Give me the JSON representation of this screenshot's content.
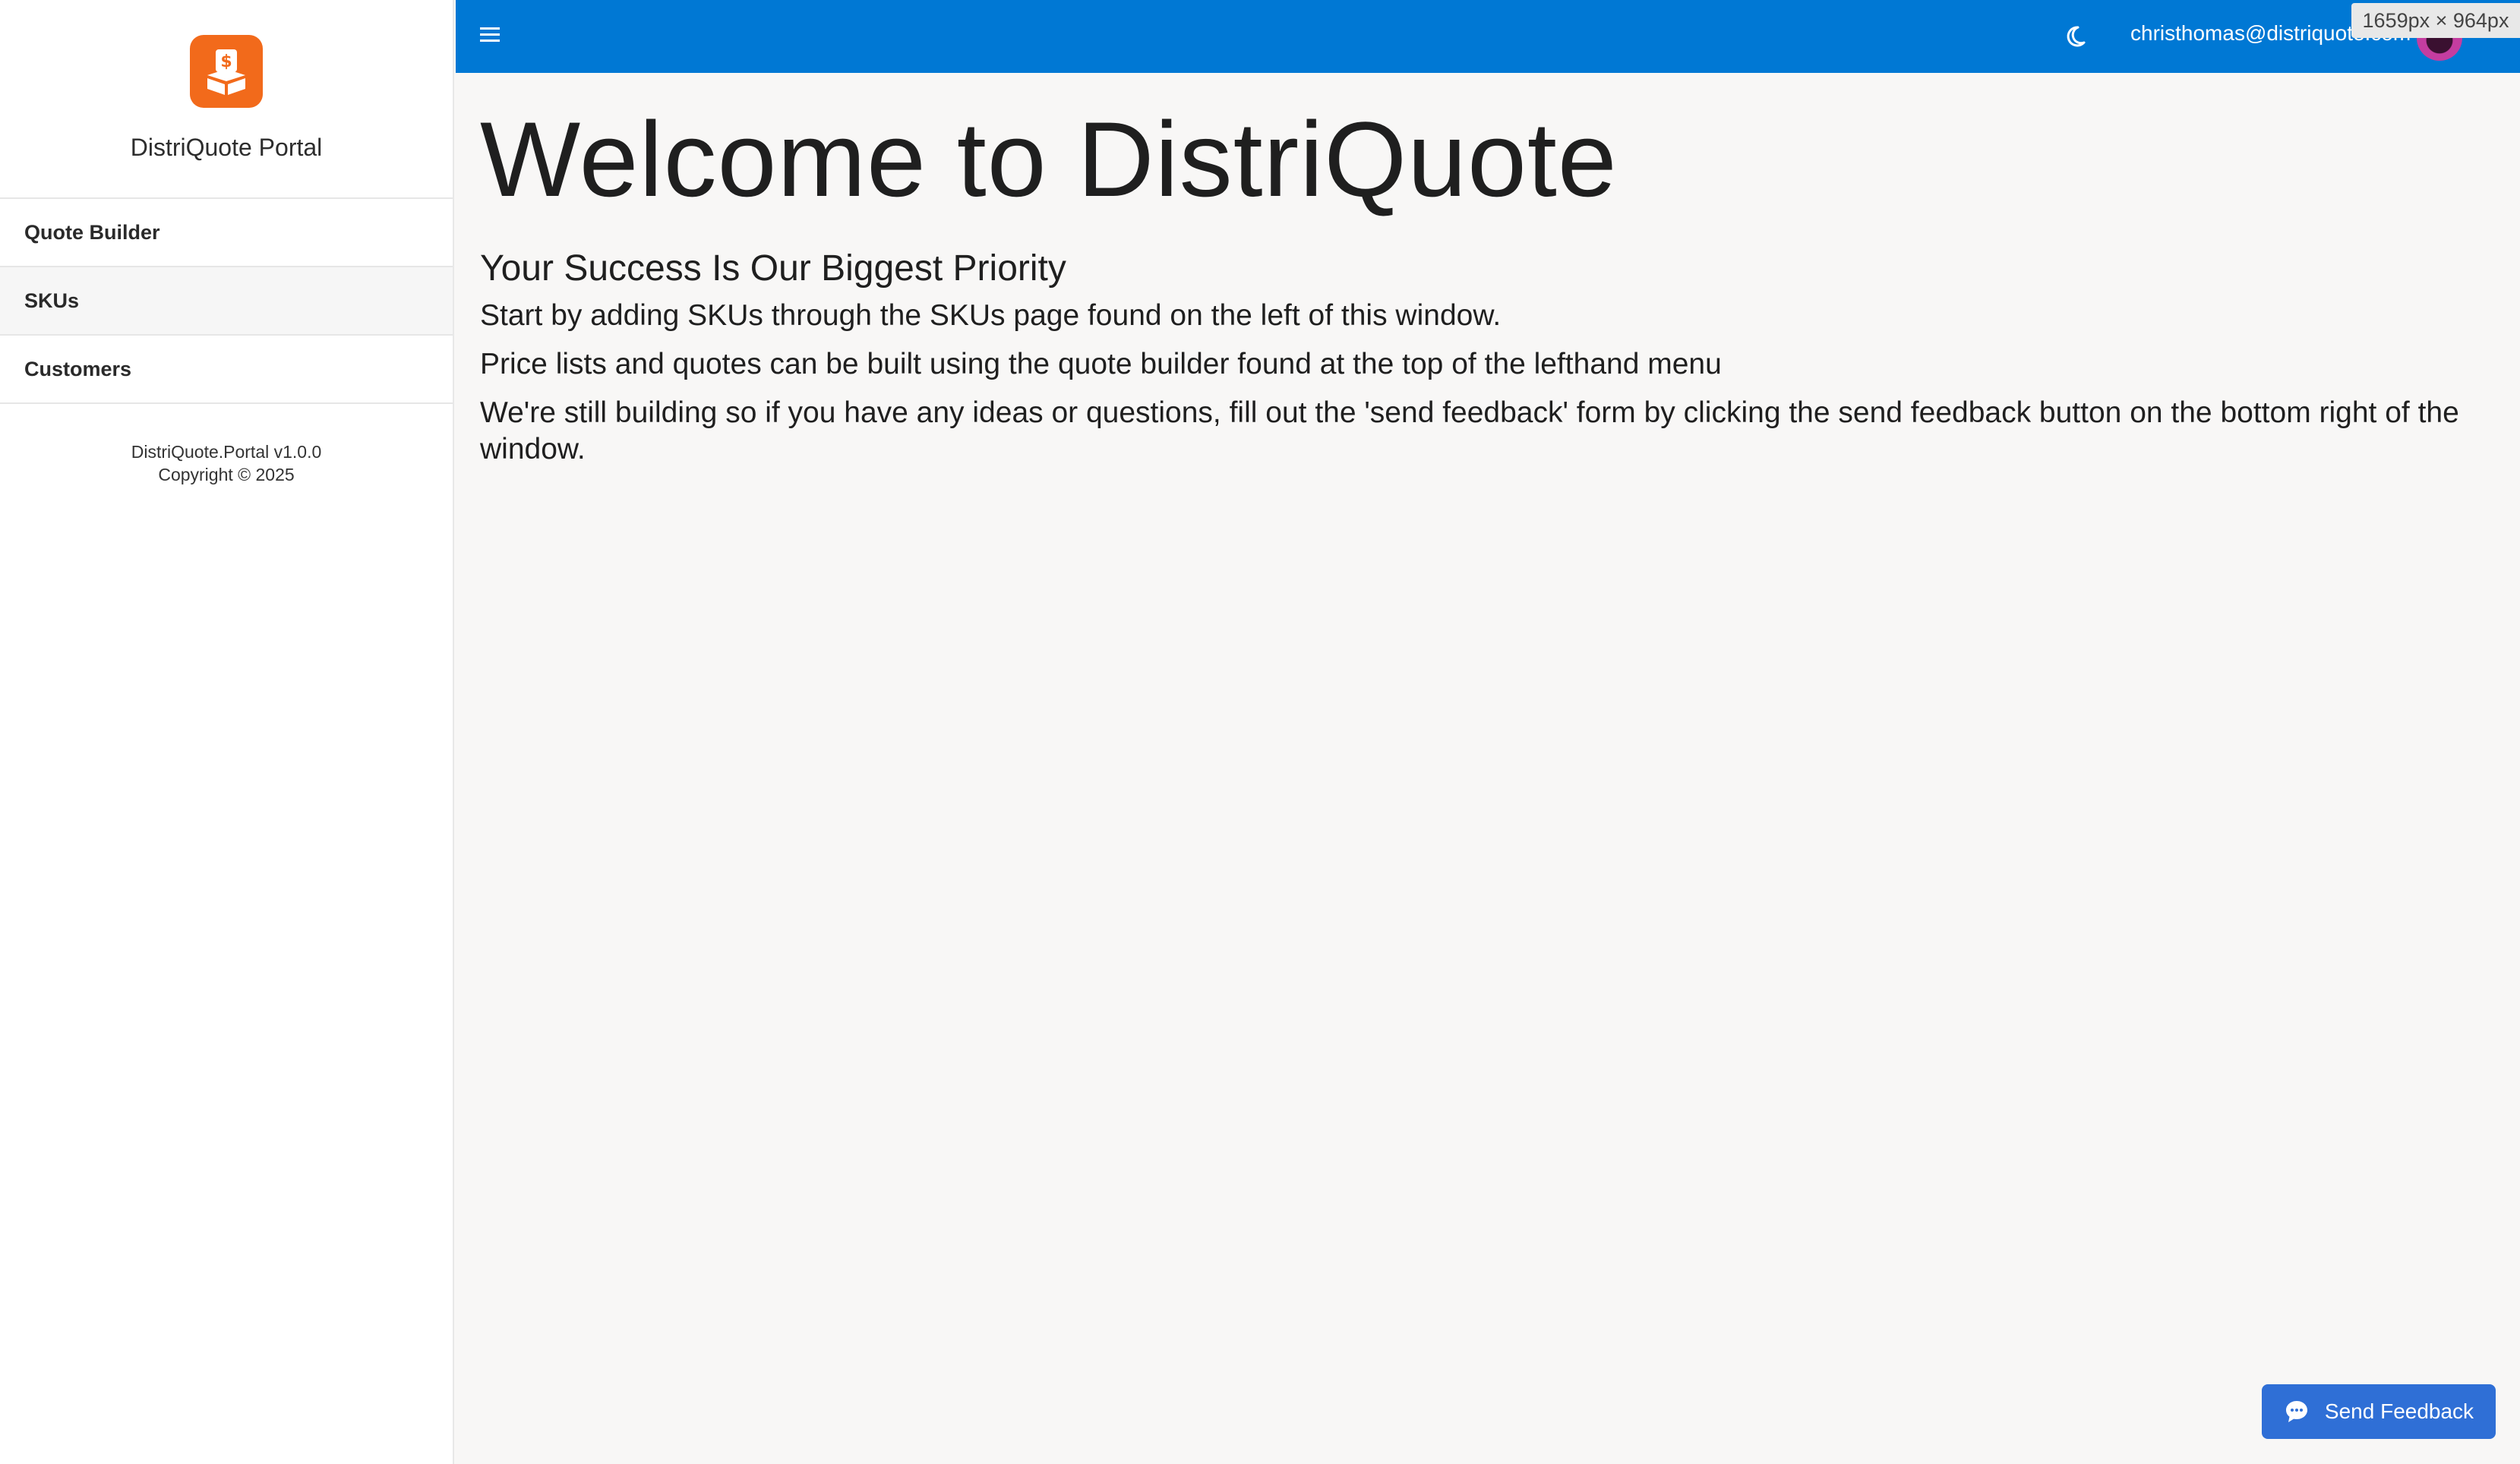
{
  "sidebar": {
    "brand_name": "DistriQuote Portal",
    "items": [
      {
        "label": "Quote Builder"
      },
      {
        "label": "SKUs"
      },
      {
        "label": "Customers"
      }
    ],
    "version": "DistriQuote.Portal v1.0.0",
    "copyright": "Copyright © 2025"
  },
  "header": {
    "user_email": "christhomas@distriquote.com",
    "viewport_badge": "1659px × 964px"
  },
  "main": {
    "title": "Welcome to DistriQuote",
    "subtitle": "Your Success Is Our Biggest Priority",
    "paragraphs": [
      "Start by adding SKUs through the SKUs page found on the left of this window.",
      "Price lists and quotes can be built using the quote builder found at the top of the lefthand menu",
      "We're still building so if you have any ideas or questions, fill out the 'send feedback' form by clicking the send feedback button on the bottom right of the window."
    ]
  },
  "feedback": {
    "label": "Send Feedback"
  },
  "colors": {
    "topbar": "#0078d4",
    "brand_orange": "#f26a1b",
    "feedback_button": "#2f6fd6"
  },
  "icons": [
    "logo-icon",
    "hamburger-icon",
    "moon-icon",
    "avatar",
    "chat-icon"
  ]
}
